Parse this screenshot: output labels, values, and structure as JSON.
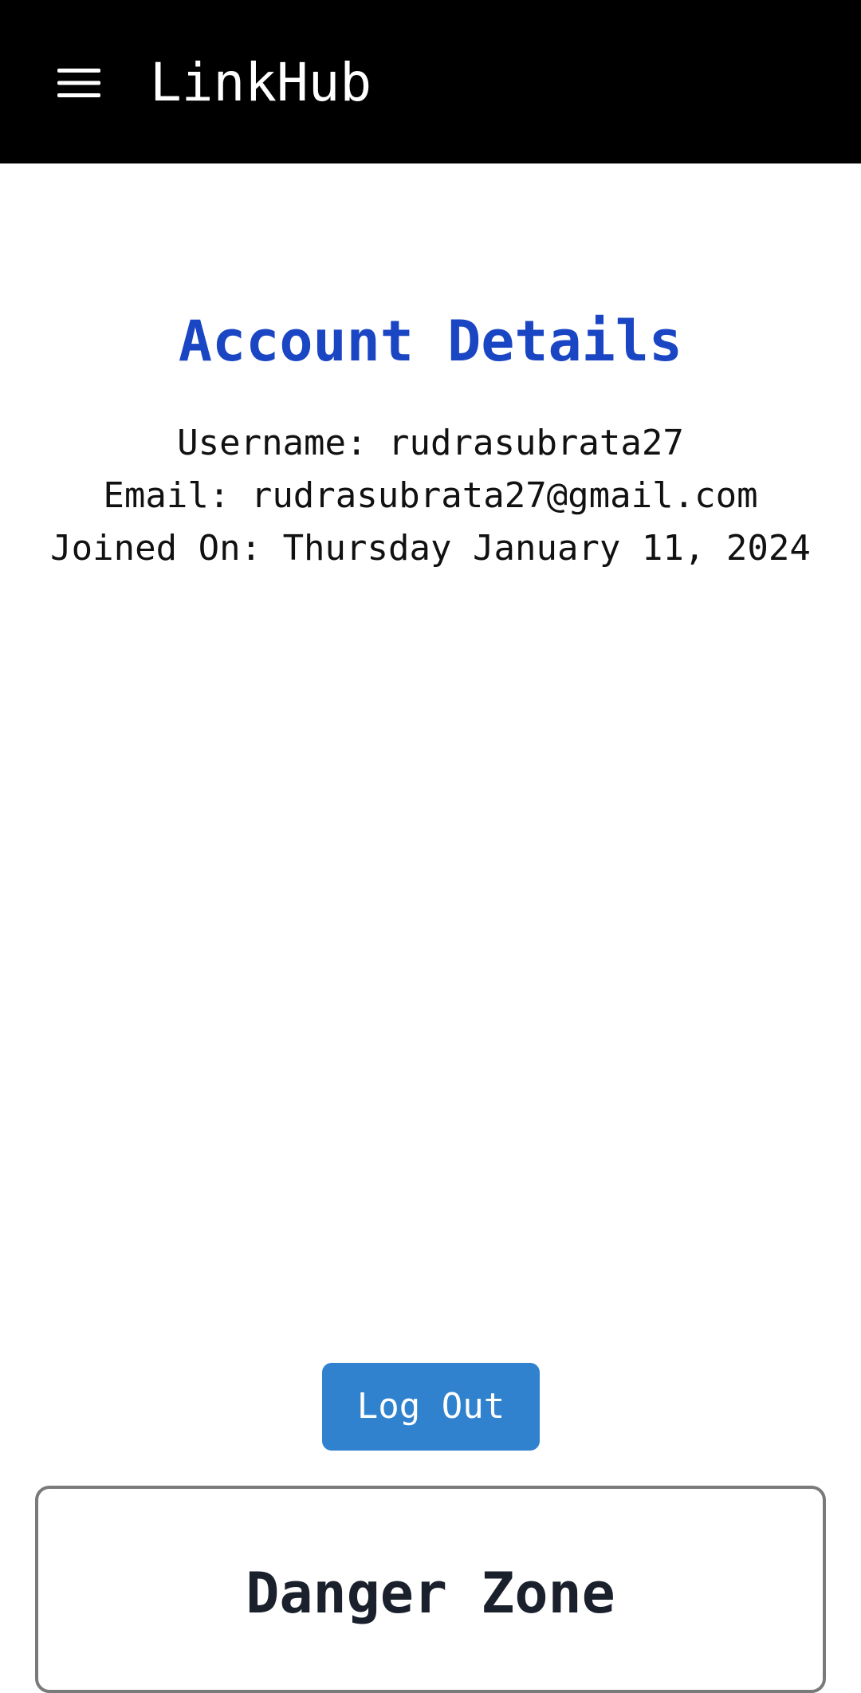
{
  "app_bar": {
    "title": "LinkHub",
    "menu_icon": "hamburger-menu-icon",
    "background": "#000000"
  },
  "account": {
    "heading": "Account Details",
    "heading_color": "#1a46c4",
    "username_line": "Username: rudrasubrata27",
    "email_line": "Email: rudrasubrata27@gmail.com",
    "joined_line": "Joined On: Thursday January 11, 2024"
  },
  "actions": {
    "logout_label": "Log Out",
    "logout_color": "#3182ce"
  },
  "danger_zone": {
    "title": "Danger Zone"
  }
}
